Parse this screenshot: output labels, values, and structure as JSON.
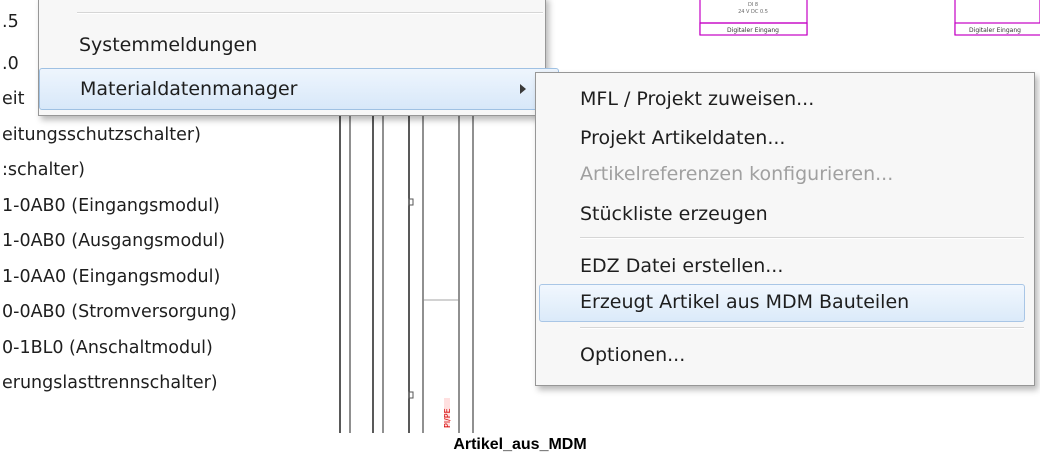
{
  "tree": {
    "lines": [
      ".5",
      ".0",
      "eit",
      "eitungsschutzschalter)",
      ":schalter)",
      "1-0AB0 (Eingangsmodul)",
      "1-0AB0 (Ausgangsmodul)",
      "1-0AA0 (Eingangsmodul)",
      "0-0AB0 (Stromversorgung)",
      "0-1BL0 (Anschaltmodul)",
      "erungslasttrennschalter)"
    ]
  },
  "schematic": {
    "block1_label": "Digitaler Eingang",
    "block1_small_text_1": "DI 8",
    "block1_small_text_2": "24 V DC 0.5",
    "block2_label": "Digitaler Eingang",
    "vertical_red_label": "Pl/PE"
  },
  "menu1": {
    "items": [
      {
        "label": "Systemmeldungen",
        "mnemonic": "l"
      },
      {
        "label": "Materialdatenmanager",
        "has_submenu": true,
        "highlighted": true
      }
    ]
  },
  "menu2": {
    "items": [
      {
        "label": "MFL / Projekt zuweisen...",
        "enabled": true
      },
      {
        "label": "Projekt Artikeldaten...",
        "enabled": true
      },
      {
        "label": "Artikelreferenzen konfigurieren...",
        "enabled": false
      },
      {
        "label": "Stückliste erzeugen",
        "enabled": true
      },
      {
        "label": "EDZ Datei erstellen...",
        "enabled": true
      },
      {
        "label": "Erzeugt Artikel aus MDM Bauteilen",
        "enabled": true,
        "highlighted": true
      },
      {
        "label": "Optionen...",
        "enabled": true
      }
    ]
  },
  "caption": "Artikel_aus_MDM",
  "colors": {
    "menu_bg": "#f7f7f7",
    "highlight_border": "#9fc1e3",
    "schematic_magenta": "#c400c4",
    "schematic_red": "#d40000"
  }
}
